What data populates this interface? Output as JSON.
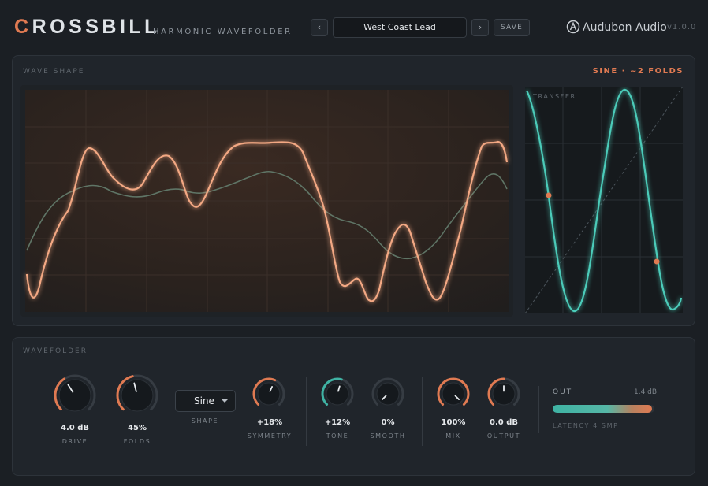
{
  "header": {
    "logo_first": "C",
    "logo_rest": "ROSSBILL",
    "subtitle": "HARMONIC WAVEFOLDER",
    "prev_label": "‹",
    "next_label": "›",
    "preset_name": "West Coast Lead",
    "save_label": "SAVE",
    "brand": "Audubon Audio",
    "version": "v1.0.0"
  },
  "wave_panel": {
    "title": "WAVE SHAPE",
    "shape_readout": "SINE · ~2 FOLDS",
    "transfer_label": "TRANSFER"
  },
  "folder_panel": {
    "title": "WAVEFOLDER",
    "knobs": [
      {
        "id": "drive",
        "label": "DRIVE",
        "value": "4.0 dB",
        "level": 0.38
      },
      {
        "id": "folds",
        "label": "FOLDS",
        "value": "45%",
        "level": 0.45
      },
      {
        "id": "symmetry",
        "label": "SYMMETRY",
        "value": "+18%",
        "level": 0.59
      },
      {
        "id": "tone",
        "label": "TONE",
        "value": "+12%",
        "level": 0.56
      },
      {
        "id": "smooth",
        "label": "SMOOTH",
        "value": "0%",
        "level": 0.0
      },
      {
        "id": "mix",
        "label": "MIX",
        "value": "100%",
        "level": 1.0
      },
      {
        "id": "output",
        "label": "OUTPUT",
        "value": "0.0 dB",
        "level": 0.5
      }
    ],
    "shape_select": {
      "label": "SHAPE",
      "value": "Sine"
    },
    "output_meter": {
      "label": "OUT",
      "db": "1.4 dB",
      "level": 0.98
    },
    "latency": "LATENCY 4 SMP"
  },
  "colors": {
    "accent": "#e07a52",
    "teal": "#3fb3a4",
    "panel": "#20252b",
    "background": "#1b1f24"
  }
}
